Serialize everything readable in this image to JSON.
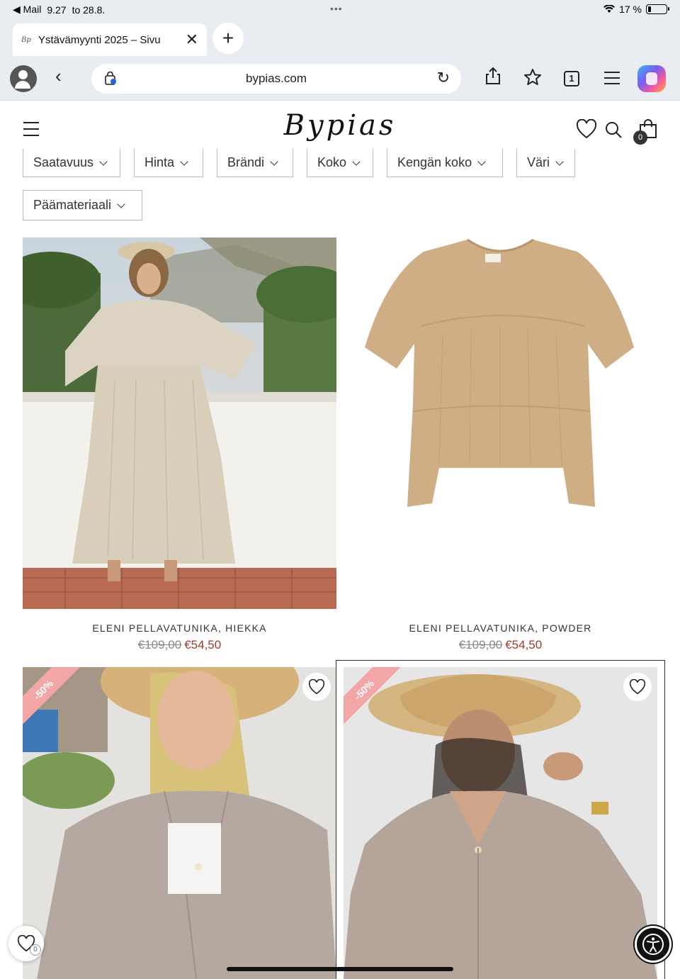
{
  "status_bar": {
    "back_app": "◀ Mail",
    "time": "9.27",
    "date": "to 28.8.",
    "battery": "17 %",
    "battery_level": 0.17
  },
  "tabs": [
    {
      "title": "Ystävämyynti 2025 – Sivu",
      "favicon": "Bp"
    }
  ],
  "toolbar": {
    "url": "bypias.com",
    "tabs_count": "1"
  },
  "site": {
    "logo": "Bypias",
    "cart_count": "0"
  },
  "filters": [
    {
      "label": "Saatavuus"
    },
    {
      "label": "Hinta"
    },
    {
      "label": "Brändi"
    },
    {
      "label": "Koko"
    },
    {
      "label": "Kengän koko"
    },
    {
      "label": "Väri"
    },
    {
      "label": "Päämateriaali"
    }
  ],
  "products": [
    {
      "name": "ELENI PELLAVATUNIKA, HIEKKA",
      "price_old": "€109,00",
      "price_new": "€54,50"
    },
    {
      "name": "ELENI PELLAVATUNIKA, POWDER",
      "price_old": "€109,00",
      "price_new": "€54,50"
    },
    {
      "name": "",
      "badge": "-50%"
    },
    {
      "name": "",
      "badge": "-50%"
    }
  ],
  "floating": {
    "wishlist_count": "0"
  },
  "colors": {
    "sale_price": "#a33a2e",
    "badge": "#f3a6a6",
    "browser_chrome": "#e9ecf1"
  }
}
